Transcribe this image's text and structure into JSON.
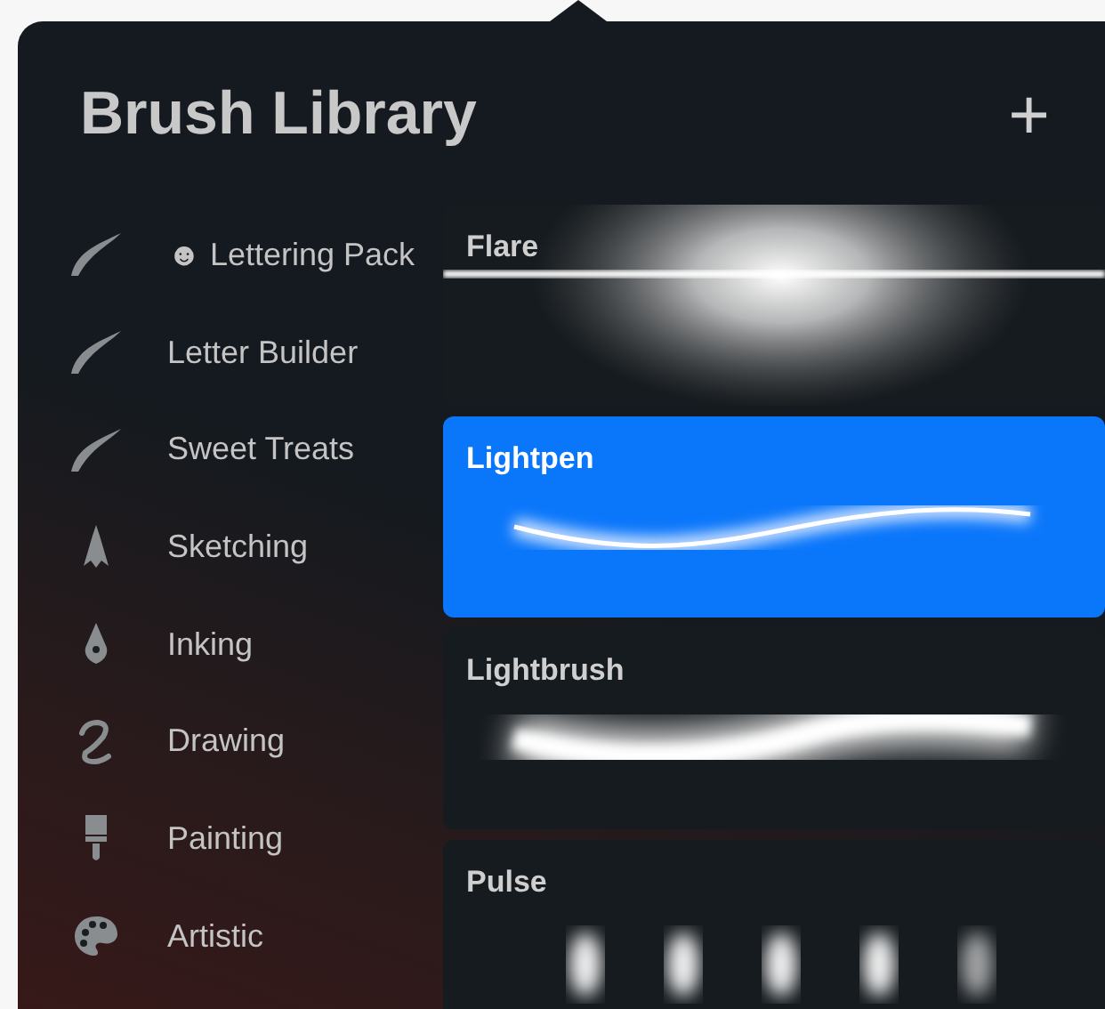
{
  "title": "Brush Library",
  "add_button": "+",
  "categories": [
    {
      "label": "☻ Lettering Pack",
      "kind": "stroke"
    },
    {
      "label": "Letter Builder",
      "kind": "stroke"
    },
    {
      "label": "Sweet Treats",
      "kind": "stroke"
    },
    {
      "label": "Sketching",
      "kind": "pencil"
    },
    {
      "label": "Inking",
      "kind": "nib"
    },
    {
      "label": "Drawing",
      "kind": "squiggle"
    },
    {
      "label": "Painting",
      "kind": "brush"
    },
    {
      "label": "Artistic",
      "kind": "palette"
    }
  ],
  "brushes": [
    {
      "name": "Flare",
      "kind": "flare",
      "selected": false
    },
    {
      "name": "Lightpen",
      "kind": "pen",
      "selected": true
    },
    {
      "name": "Lightbrush",
      "kind": "brush",
      "selected": false
    },
    {
      "name": "Pulse",
      "kind": "pulse",
      "selected": false
    }
  ]
}
